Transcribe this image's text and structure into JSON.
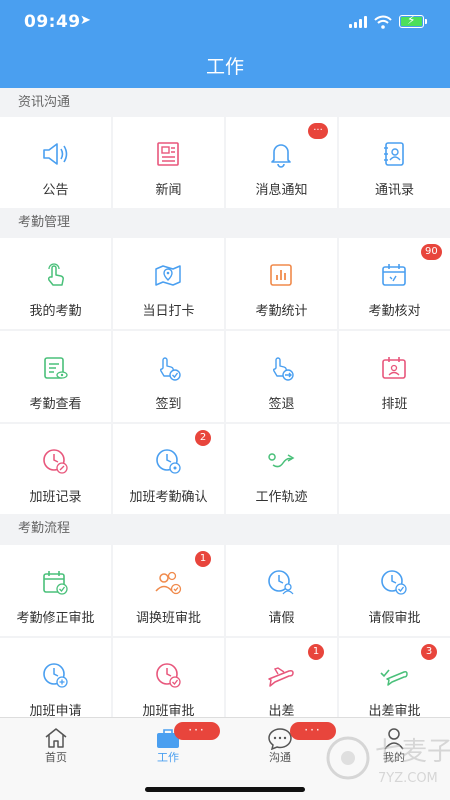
{
  "status_bar": {
    "time": "09:49"
  },
  "header": {
    "title": "工作"
  },
  "sections": [
    {
      "title": "资讯沟通"
    },
    {
      "title": "考勤管理"
    },
    {
      "title": "考勤流程"
    }
  ],
  "items": {
    "announce": "公告",
    "news": "新闻",
    "notify": "消息通知",
    "contacts": "通讯录",
    "my_attendance": "我的考勤",
    "clock_in": "当日打卡",
    "stats": "考勤统计",
    "verify": "考勤核对",
    "view": "考勤查看",
    "sign_in": "签到",
    "sign_out": "签退",
    "schedule": "排班",
    "ot_record": "加班记录",
    "ot_confirm": "加班考勤确认",
    "track": "工作轨迹",
    "correct_approve": "考勤修正审批",
    "shift_approve": "调换班审批",
    "leave": "请假",
    "leave_approve": "请假审批",
    "ot_apply": "加班申请",
    "ot_approve": "加班审批",
    "trip": "出差",
    "trip_approve": "出差审批"
  },
  "badges": {
    "notify": "···",
    "verify": "90",
    "ot_confirm": "2",
    "shift_approve": "1",
    "trip": "1",
    "trip_approve": "3"
  },
  "tabbar": {
    "home": "首页",
    "work": "工作",
    "chat": "沟通",
    "me": "我的",
    "work_badge": "···",
    "chat_badge": "···"
  },
  "watermark": {
    "brand": "七麦子",
    "domain": "7YZ.COM"
  },
  "colors": {
    "header": "#4a9ff0",
    "badge": "#e8453c",
    "active_tab": "#4a9ff0"
  }
}
